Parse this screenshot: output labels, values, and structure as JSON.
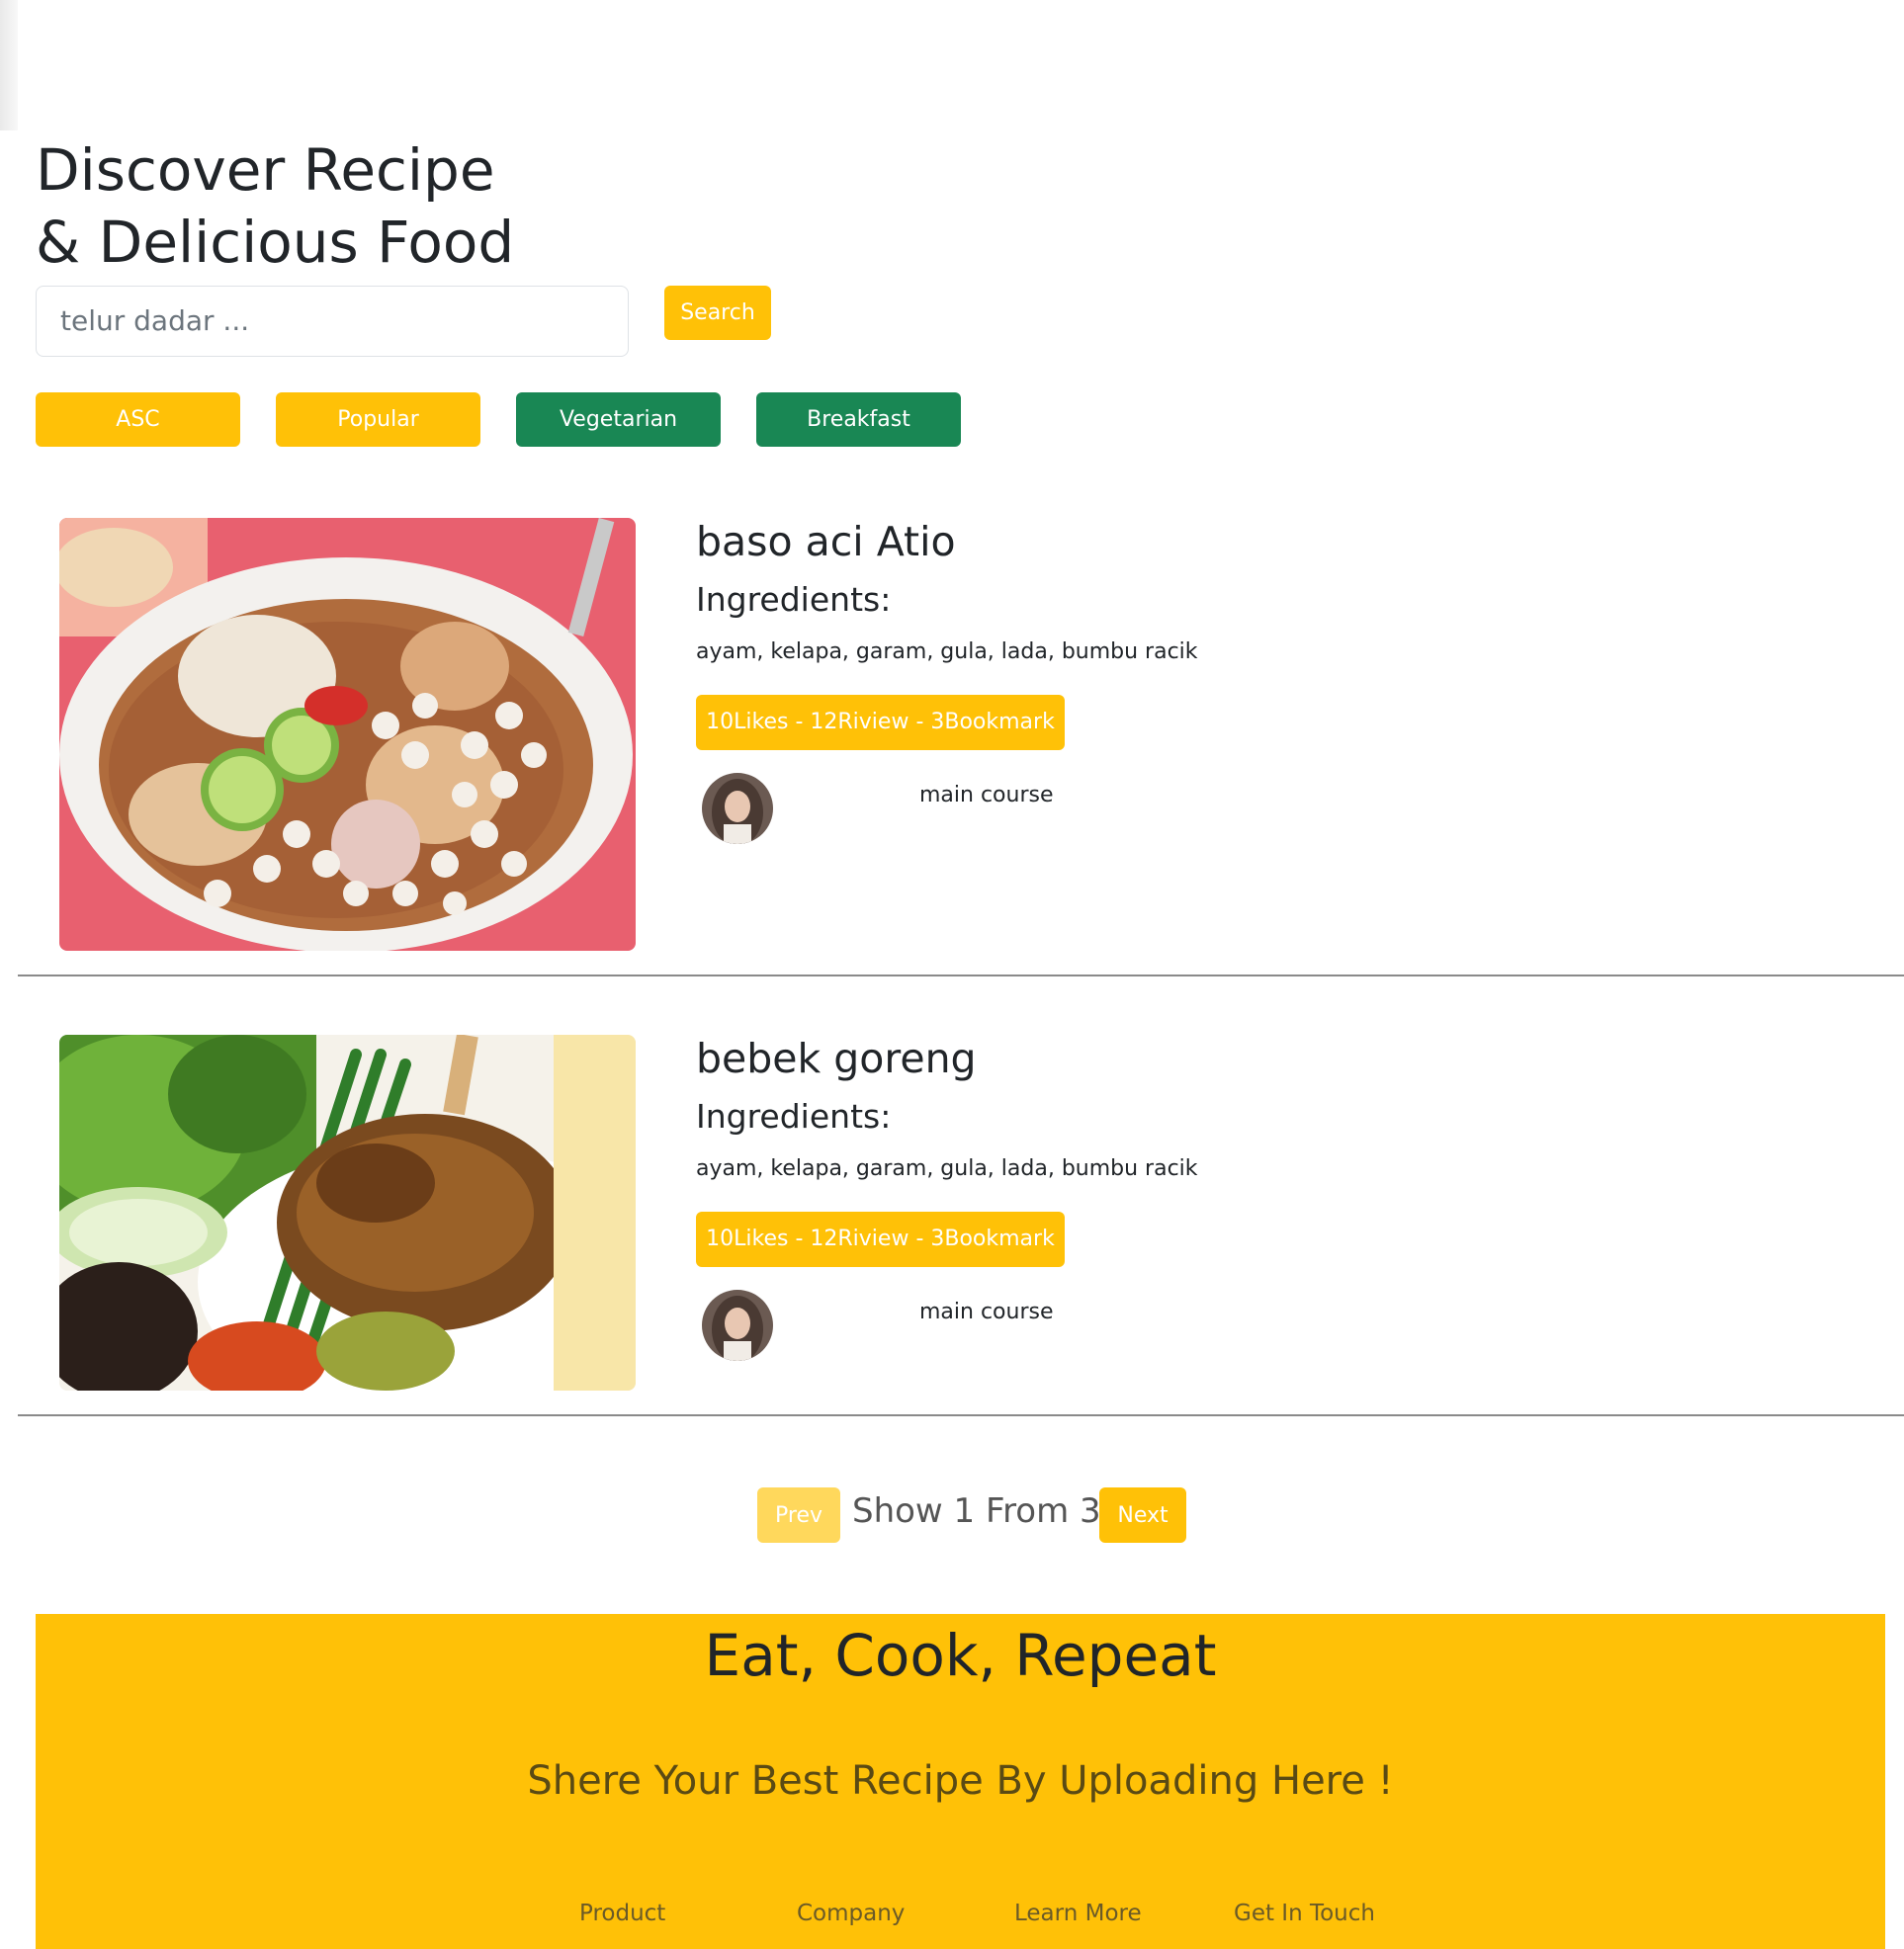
{
  "hero": {
    "title_line1": "Discover Recipe",
    "title_line2": "& Delicious Food"
  },
  "search": {
    "placeholder": "telur dadar ...",
    "button_label": "Search"
  },
  "filters": {
    "asc": "ASC",
    "popular": "Popular",
    "vegetarian": "Vegetarian",
    "breakfast": "Breakfast"
  },
  "recipes": [
    {
      "title": "baso aci Atio",
      "ingredients_heading": "Ingredients:",
      "ingredients": "ayam, kelapa, garam, gula, lada, bumbu racik",
      "stats": "10Likes - 12Riview - 3Bookmark",
      "category": "main course"
    },
    {
      "title": "bebek goreng",
      "ingredients_heading": "Ingredients:",
      "ingredients": "ayam, kelapa, garam, gula, lada, bumbu racik",
      "stats": "10Likes - 12Riview - 3Bookmark",
      "category": "main course"
    }
  ],
  "pagination": {
    "prev_label": "Prev",
    "status": "Show 1 From 3",
    "next_label": "Next"
  },
  "footer": {
    "title": "Eat, Cook, Repeat",
    "subtitle": "Shere Your Best Recipe By Uploading Here !",
    "links": [
      "Product",
      "Company",
      "Learn More",
      "Get In Touch"
    ]
  },
  "colors": {
    "primary_yellow": "#ffc107",
    "success_green": "#198754",
    "disabled_yellow": "#ffd85c"
  }
}
